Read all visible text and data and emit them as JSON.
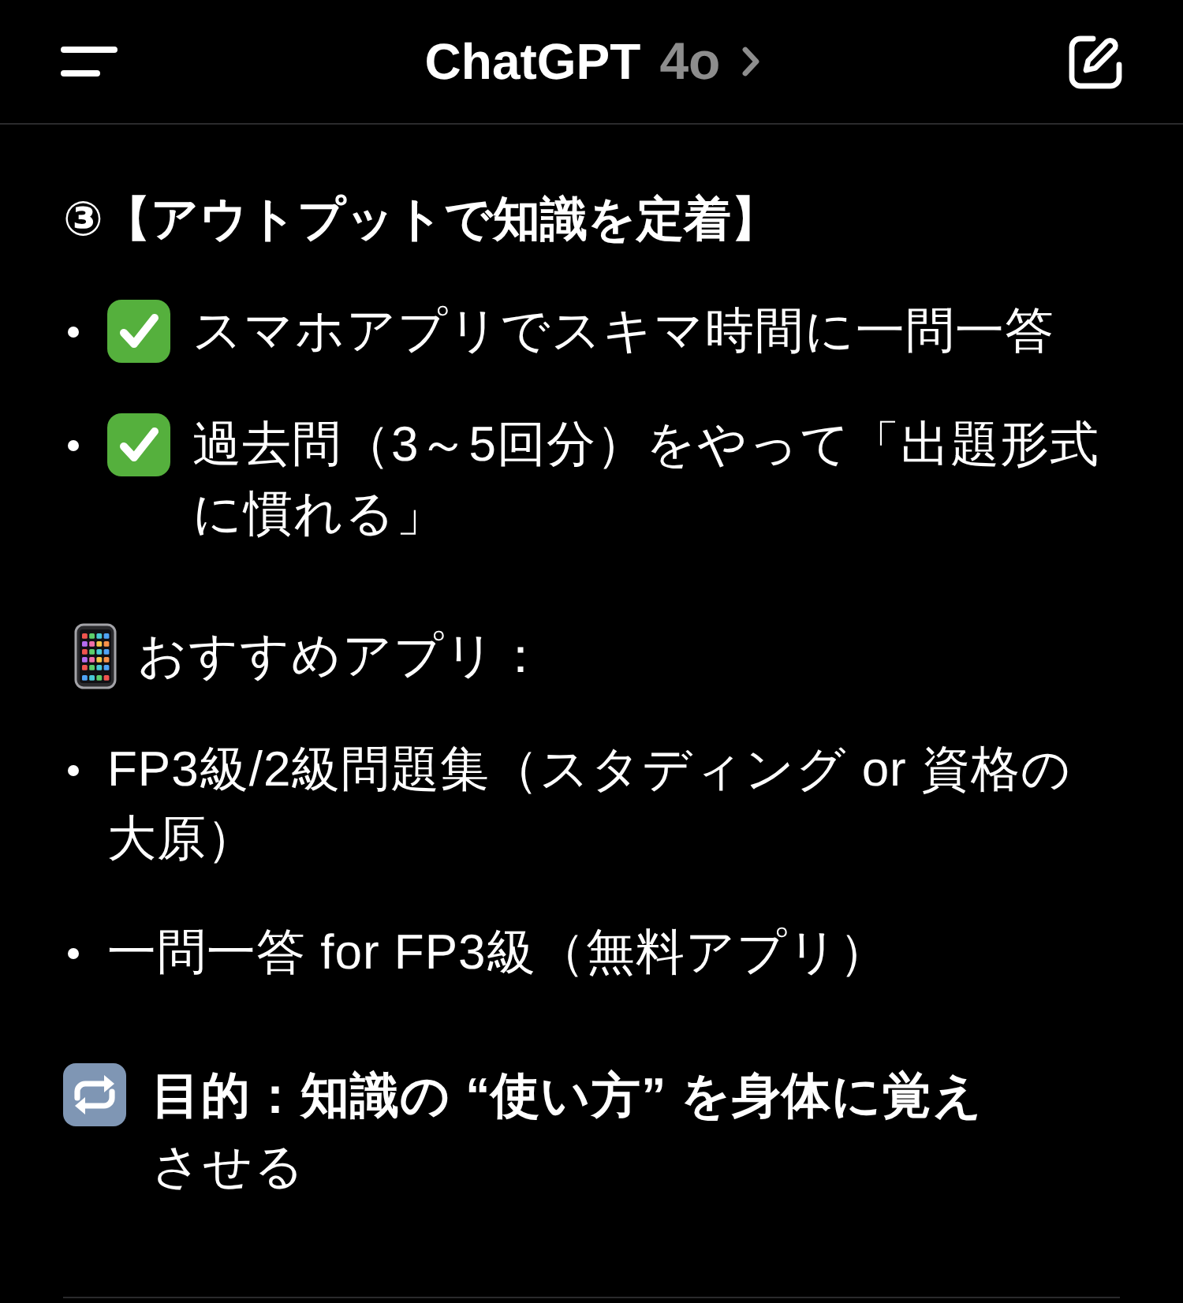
{
  "header": {
    "title": "ChatGPT",
    "model": "4o"
  },
  "blocks": [
    {
      "kind": "heading",
      "text": "③【アウトプットで知識を定着】"
    },
    {
      "kind": "checklist",
      "items": [
        "スマホアプリでスキマ時間に一問一答",
        "過去問（3～5回分）をやって「出題形式に慣れる」"
      ]
    },
    {
      "kind": "note",
      "text": "おすすめアプリ："
    },
    {
      "kind": "bullets",
      "items": [
        "FP3級/2級問題集（スタディング or 資格の大原）",
        "一問一答 for FP3級（無料アプリ）"
      ]
    },
    {
      "kind": "goal",
      "text": "**目的：知識の “使い方” を身体に覚え**させる"
    }
  ]
}
